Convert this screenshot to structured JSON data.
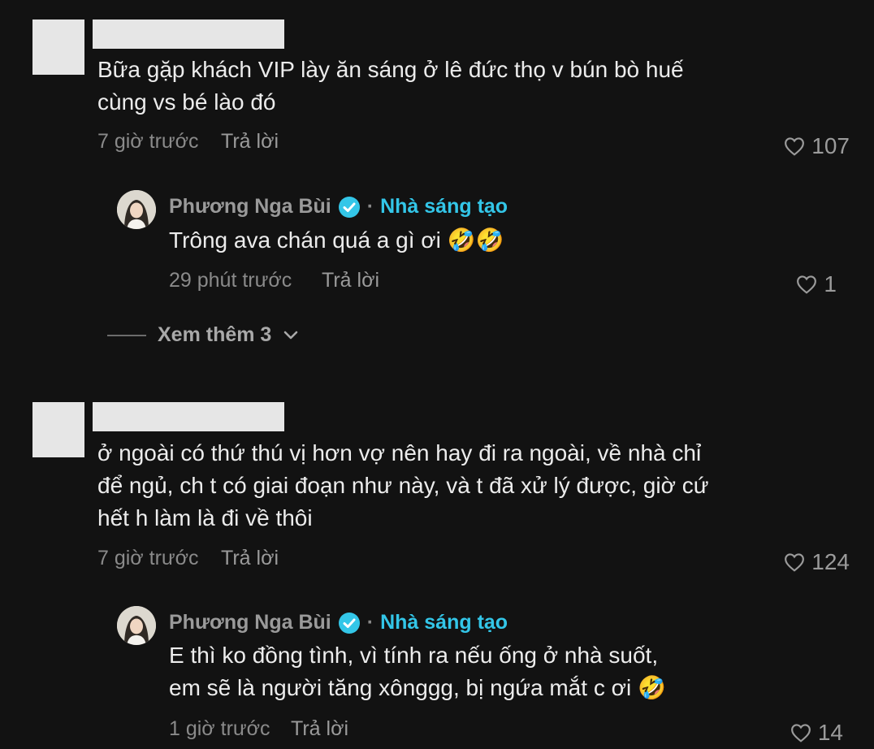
{
  "comments": [
    {
      "text_lines": [
        "Bữa gặp khách VIP lày ăn sáng ở lê đức thọ v bún bò huế",
        "cùng vs bé lào đó"
      ],
      "time": "7 giờ trước",
      "reply_label": "Trả lời",
      "likes": "107",
      "reply": {
        "author": "Phương Nga Bùi",
        "badge_label": "Nhà sáng tạo",
        "separator": "·",
        "text_lines": [
          "Trông ava chán quá a gì ơi 🤣🤣"
        ],
        "time": "29 phút trước",
        "reply_label": "Trả lời",
        "likes": "1"
      },
      "view_more": "Xem thêm 3"
    },
    {
      "text_lines": [
        "ở ngoài có thứ thú vị hơn vợ nên hay đi ra ngoài, về nhà chỉ",
        "để ngủ, ch t có giai đoạn như này, và t đã xử lý được, giờ cứ",
        "hết h làm là đi về thôi"
      ],
      "time": "7 giờ trước",
      "reply_label": "Trả lời",
      "likes": "124",
      "reply": {
        "author": "Phương Nga Bùi",
        "badge_label": "Nhà sáng tạo",
        "separator": "·",
        "text_lines": [
          "E thì ko đồng tình, vì tính ra nếu ống ở nhà suốt,",
          "em sẽ là người tăng xônggg, bị ngứa mắt c ơi 🤣"
        ],
        "time": "1 giờ trước",
        "reply_label": "Trả lời",
        "likes": "14"
      }
    }
  ],
  "colors": {
    "background": "#121212",
    "creator_badge": "#33c6e8",
    "meta_text": "#8a8a8a"
  },
  "icons": [
    "heart-outline-icon",
    "verified-badge-icon",
    "chevron-down-icon"
  ]
}
